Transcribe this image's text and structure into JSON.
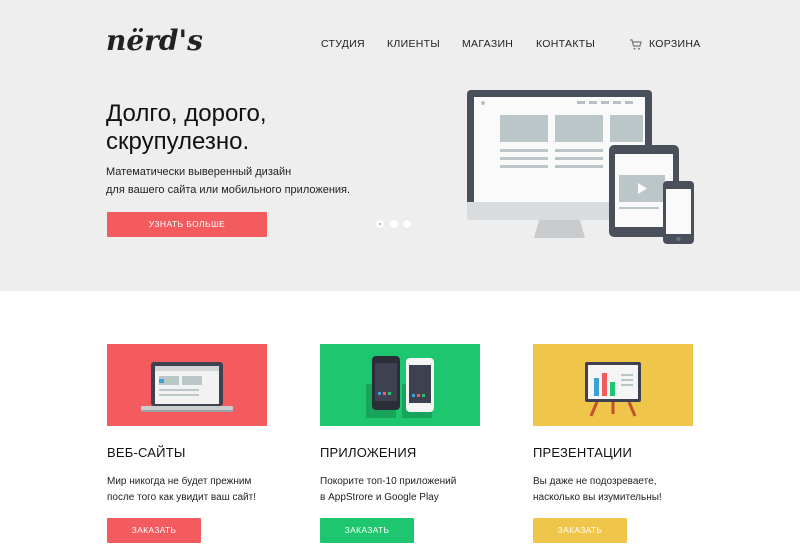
{
  "logo": {
    "text": "nërd's"
  },
  "nav": {
    "items": [
      "СТУДИЯ",
      "КЛИЕНТЫ",
      "МАГАЗИН",
      "КОНТАКТЫ"
    ],
    "cart_label": "КОРЗИНА"
  },
  "hero": {
    "title_line1": "Долго, дорого,",
    "title_line2": "скрупулезно.",
    "subtitle_line1": "Математически выверенный дизайн",
    "subtitle_line2": "для вашего сайта или мобильного приложения.",
    "button_label": "УЗНАТЬ БОЛЬШЕ",
    "slides_count": 3,
    "active_slide": 1
  },
  "services": [
    {
      "title": "ВЕБ-САЙТЫ",
      "text_line1": "Мир никогда не будет прежним",
      "text_line2": "после того как увидит ваш сайт!",
      "button_label": "ЗАКАЗАТЬ",
      "color": "#f45b5e",
      "icon": "laptop-icon"
    },
    {
      "title": "ПРИЛОЖЕНИЯ",
      "text_line1": "Покорите топ-10 приложений",
      "text_line2": "в AppStrore и Google Play",
      "button_label": "ЗАКАЗАТЬ",
      "color": "#1ec76f",
      "icon": "smartphones-icon"
    },
    {
      "title": "ПРЕЗЕНТАЦИИ",
      "text_line1": "Вы даже не подозреваете,",
      "text_line2": "насколько вы изумительны!",
      "button_label": "ЗАКАЗАТЬ",
      "color": "#efc64a",
      "icon": "presentation-board-icon"
    }
  ],
  "colors": {
    "hero_bg": "#eeeeee",
    "accent_red": "#f45b5e",
    "accent_green": "#1ec76f",
    "accent_yellow": "#efc64a",
    "device_dark": "#4a4f5c"
  }
}
